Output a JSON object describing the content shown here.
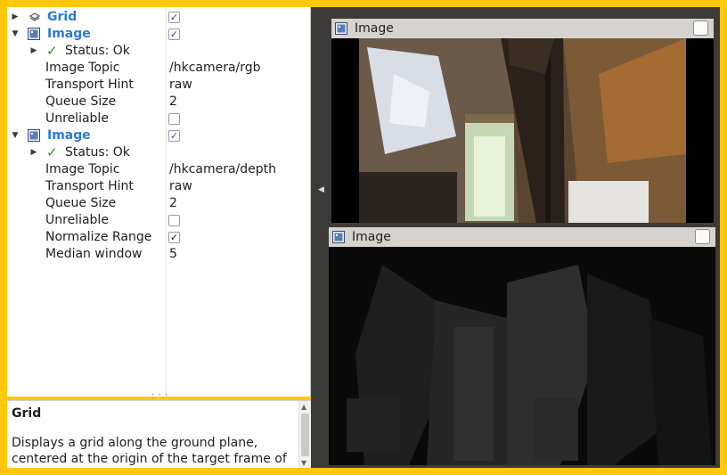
{
  "displays": {
    "grid": {
      "label": "Grid",
      "checked": "✓"
    },
    "image_rgb": {
      "label": "Image",
      "checked": "✓",
      "status": "Status: Ok",
      "props": [
        {
          "label": "Image Topic",
          "value": "/hkcamera/rgb"
        },
        {
          "label": "Transport Hint",
          "value": "raw"
        },
        {
          "label": "Queue Size",
          "value": "2"
        },
        {
          "label": "Unreliable",
          "value": ""
        }
      ]
    },
    "image_depth": {
      "label": "Image",
      "checked": "✓",
      "status": "Status: Ok",
      "props": [
        {
          "label": "Image Topic",
          "value": "/hkcamera/depth"
        },
        {
          "label": "Transport Hint",
          "value": "raw"
        },
        {
          "label": "Queue Size",
          "value": "2"
        },
        {
          "label": "Unreliable",
          "value": ""
        },
        {
          "label": "Normalize Range",
          "value": "✓"
        },
        {
          "label": "Median window",
          "value": "5"
        }
      ]
    }
  },
  "description": {
    "title": "Grid",
    "text": "Displays a grid along the ground plane, centered at the origin of the target frame of"
  },
  "panels": {
    "rgb": {
      "title": "Image"
    },
    "depth": {
      "title": "Image"
    }
  },
  "colors": {
    "frame": "#fec90c",
    "plugin_label": "#2a7bd6",
    "status_ok": "#2e8b2e",
    "panel_bg": "#3c3b37"
  },
  "icons": {
    "grid": "grid-layers-icon",
    "image": "image-display-icon",
    "status": "checkmark-icon",
    "expand": "triangle-right-icon",
    "collapse": "triangle-down-icon"
  }
}
